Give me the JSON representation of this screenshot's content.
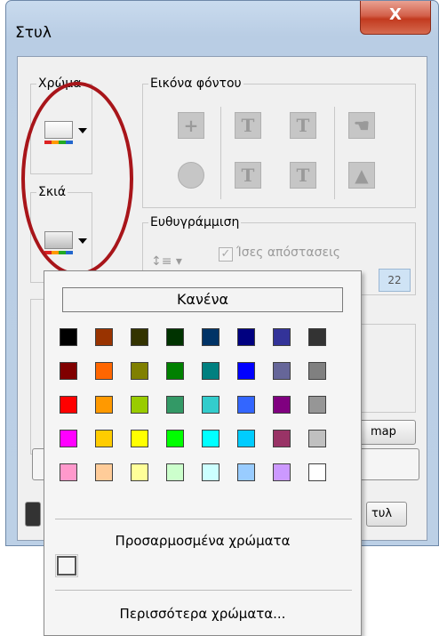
{
  "window": {
    "title": "Στυλ",
    "close_label": "X"
  },
  "groups": {
    "color": "Χρώμα",
    "shadow": "Σκιά",
    "background_image": "Εικόνα φόντου",
    "alignment": "Ευθυγράμμιση"
  },
  "alignment": {
    "equal_spacing_label": "Ίσες απόστασεις",
    "equal_spacing_checked": true,
    "spacing_value": "22"
  },
  "background_icons": [
    {
      "name": "insert-image-icon",
      "glyph": "+"
    },
    {
      "name": "text-icon",
      "glyph": "T"
    },
    {
      "name": "text-clear-icon",
      "glyph": "T"
    },
    {
      "name": "hand-image-icon",
      "glyph": "☚"
    },
    {
      "name": "no-image-icon",
      "glyph": ""
    },
    {
      "name": "text-fill-icon",
      "glyph": "T"
    },
    {
      "name": "text-stretch-icon",
      "glyph": "T"
    },
    {
      "name": "landscape-image-icon",
      "glyph": "▲"
    }
  ],
  "side_buttons": {
    "bitmap_label": "map",
    "style_label": "τυλ"
  },
  "palette": {
    "none_label": "Κανένα",
    "rows": [
      [
        "#000000",
        "#993300",
        "#333300",
        "#003300",
        "#003366",
        "#000080",
        "#333399",
        "#333333"
      ],
      [
        "#800000",
        "#FF6600",
        "#808000",
        "#008000",
        "#008080",
        "#0000FF",
        "#666699",
        "#808080"
      ],
      [
        "#FF0000",
        "#FF9900",
        "#99CC00",
        "#339966",
        "#33CCCC",
        "#3366FF",
        "#800080",
        "#969696"
      ],
      [
        "#FF00FF",
        "#FFCC00",
        "#FFFF00",
        "#00FF00",
        "#00FFFF",
        "#00CCFF",
        "#993366",
        "#C0C0C0"
      ],
      [
        "#FF99CC",
        "#FFCC99",
        "#FFFF99",
        "#CCFFCC",
        "#CCFFFF",
        "#99CCFF",
        "#CC99FF",
        "#FFFFFF"
      ]
    ],
    "custom_title": "Προσαρμοσμένα χρώματα",
    "more_colors_label": "Περισσότερα χρώματα..."
  },
  "colors": {
    "annotation": "#A8151A",
    "accent_field": "#CFE3F5"
  }
}
